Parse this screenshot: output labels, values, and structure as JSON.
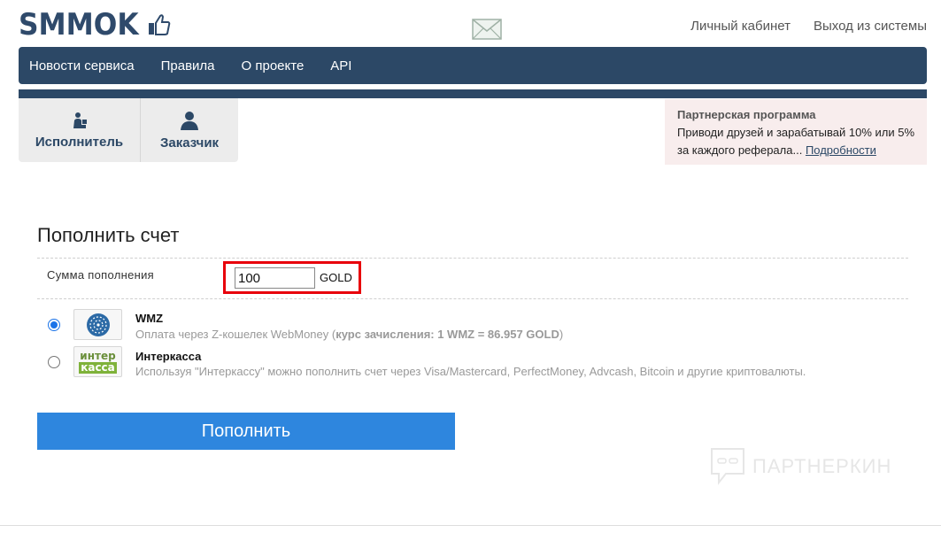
{
  "header": {
    "logo_text": "SMMOK",
    "links": {
      "cabinet": "Личный кабинет",
      "logout": "Выход из системы"
    }
  },
  "nav": {
    "items": [
      "Новости сервиса",
      "Правила",
      "О проекте",
      "API"
    ]
  },
  "roles": {
    "executor": "Исполнитель",
    "customer": "Заказчик"
  },
  "partner": {
    "title": "Партнерская программа",
    "text": "Приводи друзей и зарабатывай 10% или 5% за каждого реферала... ",
    "link": "Подробности"
  },
  "form": {
    "title": "Пополнить счет",
    "amount_label": "Сумма пополнения",
    "amount_value": "100",
    "amount_unit": "GOLD",
    "methods": [
      {
        "name": "WMZ",
        "desc_prefix": "Оплата через Z-кошелек WebMoney (",
        "desc_bold": "курс зачисления: 1 WMZ = 86.957 GOLD",
        "desc_suffix": ")",
        "selected": true
      },
      {
        "name": "Интеркасса",
        "desc": "Используя \"Интеркассу\" можно пополнить счет через Visa/Mastercard, PerfectMoney, Advcash, Bitcoin и другие криптовалюты.",
        "logo_top": "интер",
        "logo_bottom": "касса",
        "selected": false
      }
    ],
    "submit_label": "Пополнить"
  },
  "watermark": "ПАРТНЕРКИН",
  "colors": {
    "nav_bg": "#2c4866",
    "button": "#2e86de",
    "highlight": "#e8000b",
    "partner_bg": "#f8eded"
  }
}
